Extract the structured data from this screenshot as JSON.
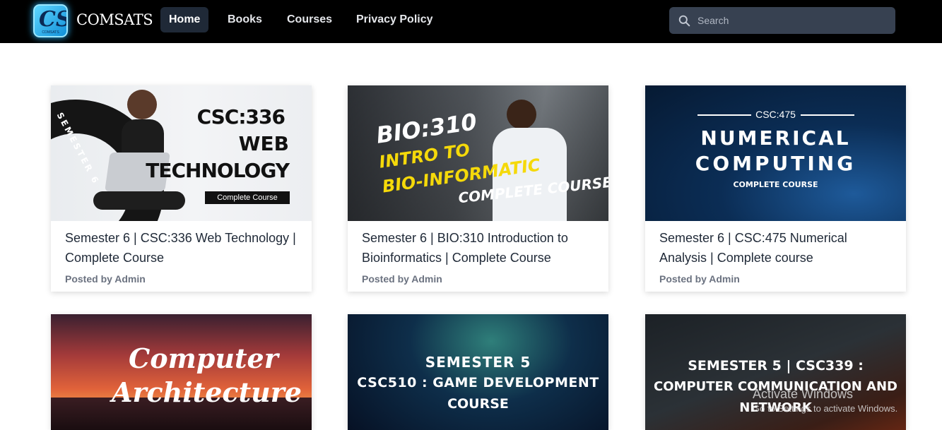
{
  "navbar": {
    "brand": "COMSATS",
    "logo_letters": "CS",
    "logo_sub": "COMSATS",
    "items": [
      {
        "label": "Home",
        "active": true
      },
      {
        "label": "Books",
        "active": false
      },
      {
        "label": "Courses",
        "active": false
      },
      {
        "label": "Privacy Policy",
        "active": false
      }
    ],
    "search": {
      "placeholder": "Search",
      "icon": "search-icon"
    }
  },
  "cards": [
    {
      "title": "Semester 6 | CSC:336 Web Technology | Complete Course",
      "meta": "Posted by Admin",
      "thumb": {
        "ring_text": "SEMESTER 6",
        "code": "CSC:336",
        "line1": "WEB",
        "line2": "TECHNOLOGY",
        "badge": "Complete Course"
      }
    },
    {
      "title": "Semester 6 | BIO:310 Introduction to Bioinformatics | Complete Course",
      "meta": "Posted by Admin",
      "thumb": {
        "code": "BIO:310",
        "line1": "INTRO TO",
        "line2": "BIO-INFORMATIC",
        "line3": "COMPLETE COURSE"
      }
    },
    {
      "title": "Semester 6 | CSC:475 Numerical Analysis | Complete course",
      "meta": "Posted by Admin",
      "thumb": {
        "code": "CSC:475",
        "line1": "NUMERICAL",
        "line2": "COMPUTING",
        "line3": "COMPLETE COURSE"
      }
    },
    {
      "thumb": {
        "line1": "Computer",
        "line2": "Architecture"
      }
    },
    {
      "thumb": {
        "line1": "SEMESTER 5",
        "line2": "CSC510 : GAME DEVELOPMENT",
        "line3": "COURSE"
      }
    },
    {
      "thumb": {
        "line1": "SEMESTER 5 | CSC339 :",
        "line2": "COMPUTER COMMUNICATION AND",
        "line3": "NETWORK"
      }
    }
  ],
  "watermark": {
    "line1": "Activate Windows",
    "line2": "Go to Settings to activate Windows."
  }
}
